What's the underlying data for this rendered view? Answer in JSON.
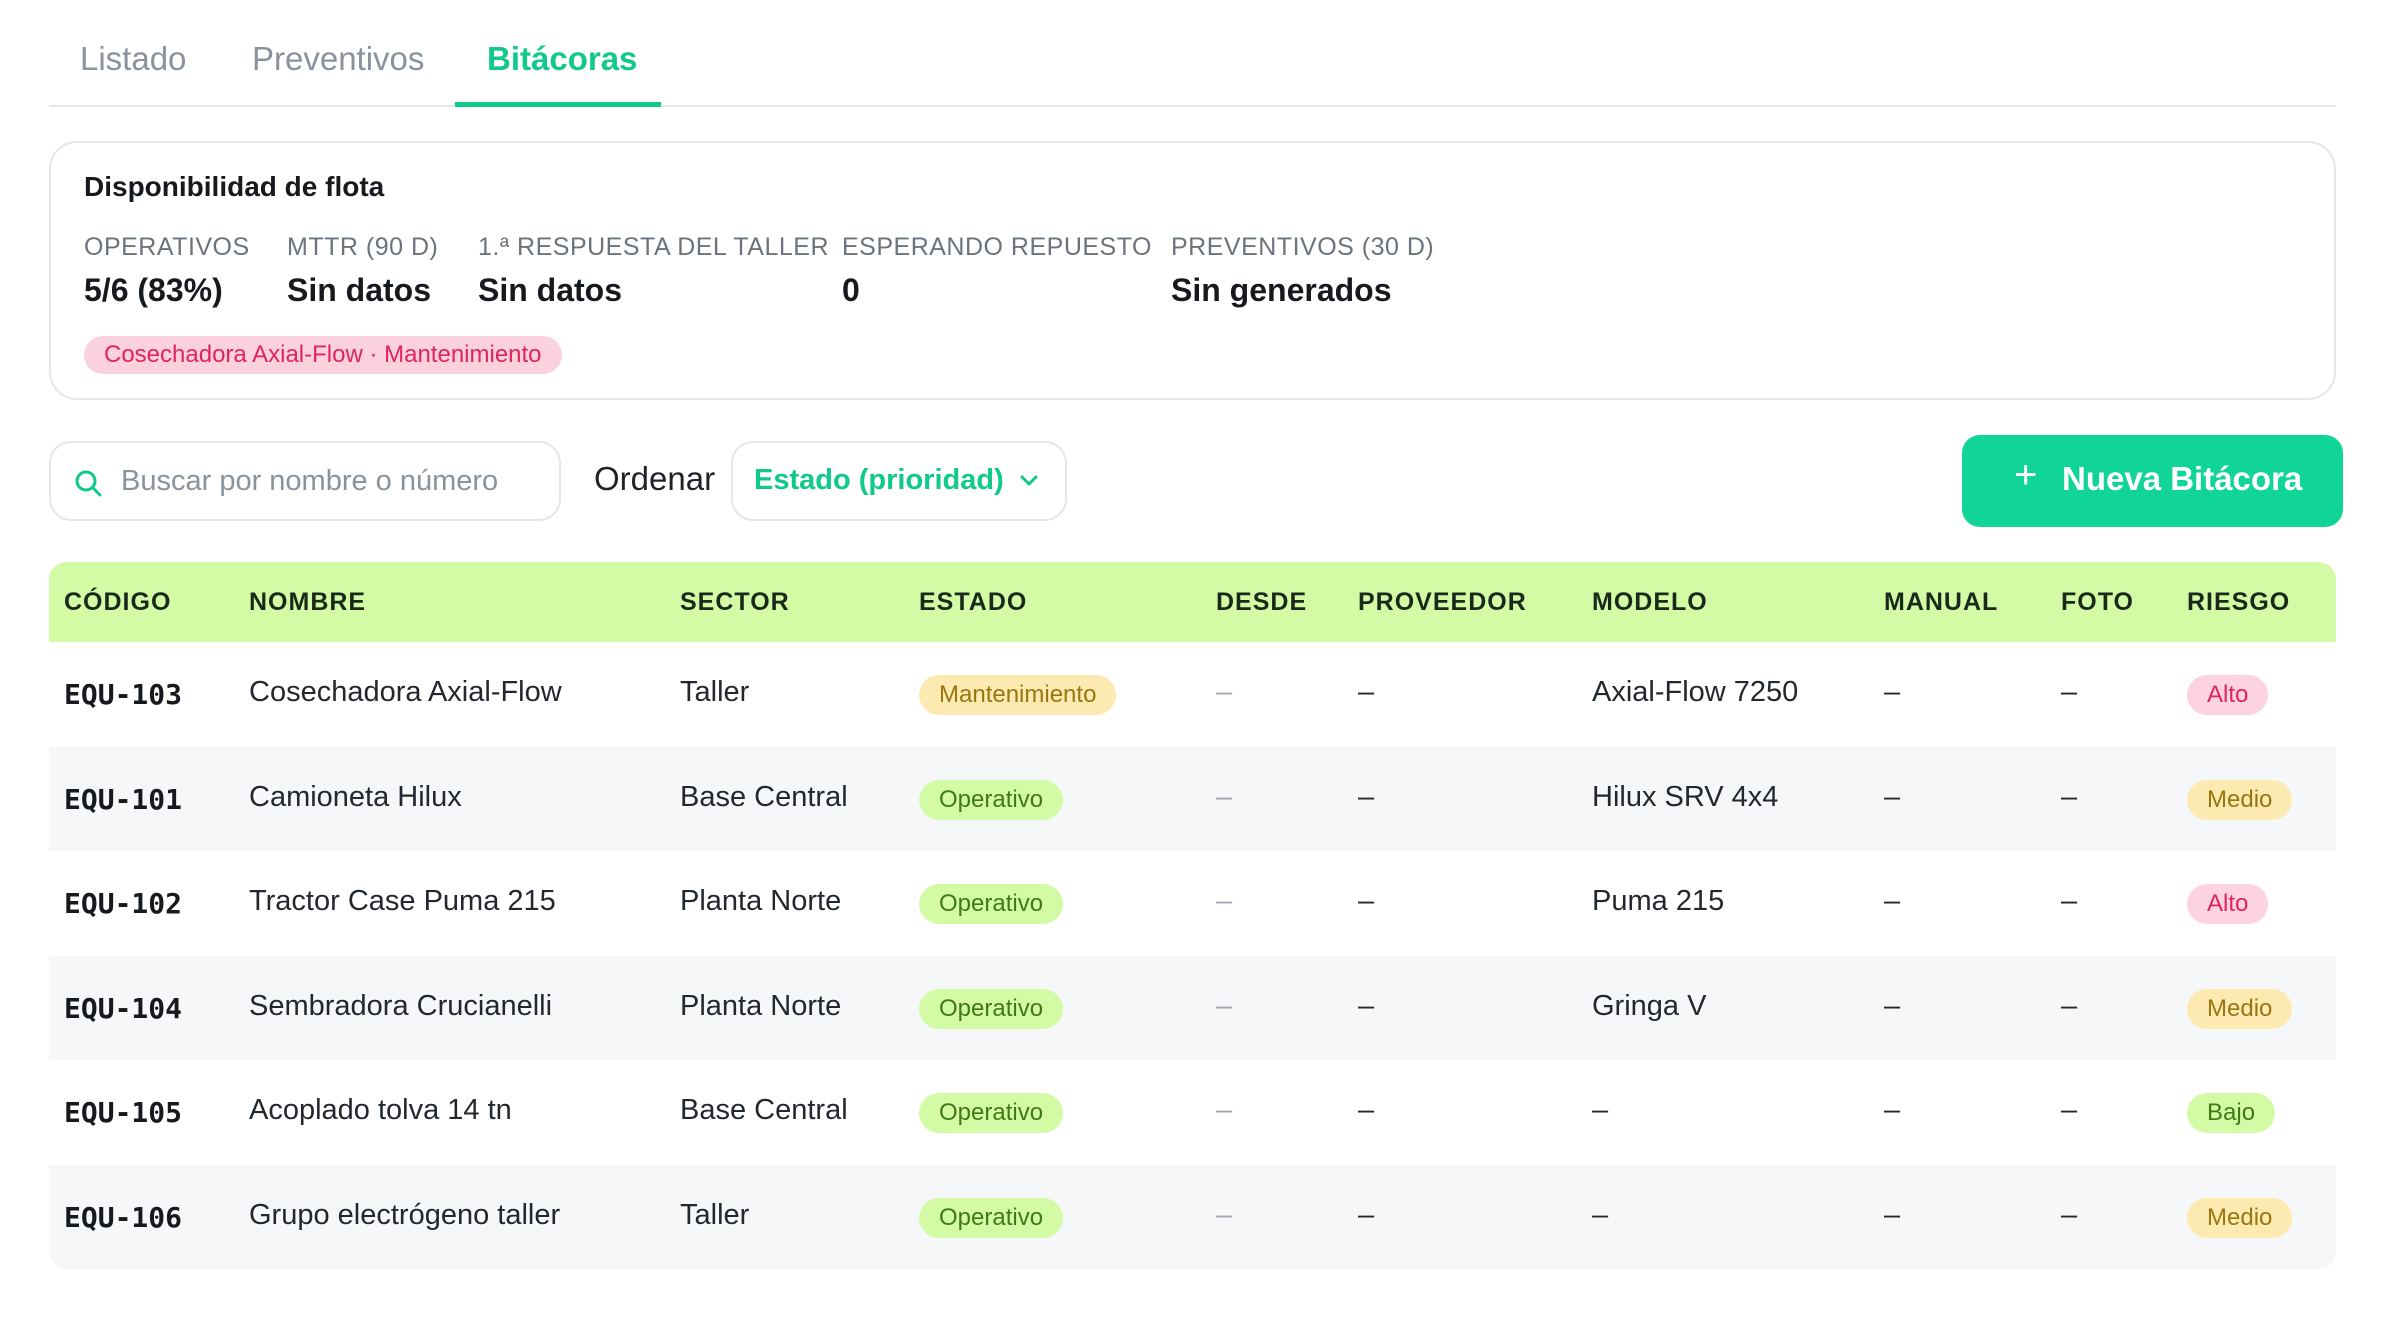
{
  "tabs": [
    {
      "label": "Listado"
    },
    {
      "label": "Preventivos"
    },
    {
      "label": "Bitácoras"
    }
  ],
  "fleet": {
    "title": "Disponibilidad de flota",
    "metrics": [
      {
        "label": "OPERATIVOS",
        "value": "5/6 (83%)"
      },
      {
        "label": "MTTR (90 D)",
        "value": "Sin datos"
      },
      {
        "label": "1.ª RESPUESTA DEL TALLER",
        "value": "Sin datos"
      },
      {
        "label": "ESPERANDO REPUESTO",
        "value": "0"
      },
      {
        "label": "PREVENTIVOS (30 D)",
        "value": "Sin generados"
      }
    ],
    "alert_chip": "Cosechadora Axial-Flow · Mantenimiento"
  },
  "controls": {
    "search_placeholder": "Buscar por nombre o número",
    "sort_label": "Ordenar",
    "sort_value": "Estado (prioridad)",
    "new_button": "Nueva Bitácora"
  },
  "colors": {
    "accent": "#10c98a",
    "header_bg": "#d3fba6"
  },
  "table": {
    "headers": [
      "CÓDIGO",
      "NOMBRE",
      "SECTOR",
      "ESTADO",
      "DESDE",
      "PROVEEDOR",
      "MODELO",
      "MANUAL",
      "FOTO",
      "RIESGO"
    ],
    "rows": [
      {
        "codigo": "EQU-103",
        "nombre": "Cosechadora Axial-Flow",
        "sector": "Taller",
        "estado": "Mantenimiento",
        "desde": "–",
        "proveedor": "–",
        "modelo": "Axial-Flow 7250",
        "manual": "–",
        "foto": "–",
        "riesgo": "Alto"
      },
      {
        "codigo": "EQU-101",
        "nombre": "Camioneta Hilux",
        "sector": "Base Central",
        "estado": "Operativo",
        "desde": "–",
        "proveedor": "–",
        "modelo": "Hilux SRV 4x4",
        "manual": "–",
        "foto": "–",
        "riesgo": "Medio"
      },
      {
        "codigo": "EQU-102",
        "nombre": "Tractor Case Puma 215",
        "sector": "Planta Norte",
        "estado": "Operativo",
        "desde": "–",
        "proveedor": "–",
        "modelo": "Puma 215",
        "manual": "–",
        "foto": "–",
        "riesgo": "Alto"
      },
      {
        "codigo": "EQU-104",
        "nombre": "Sembradora Crucianelli",
        "sector": "Planta Norte",
        "estado": "Operativo",
        "desde": "–",
        "proveedor": "–",
        "modelo": "Gringa V",
        "manual": "–",
        "foto": "–",
        "riesgo": "Medio"
      },
      {
        "codigo": "EQU-105",
        "nombre": "Acoplado tolva 14 tn",
        "sector": "Base Central",
        "estado": "Operativo",
        "desde": "–",
        "proveedor": "–",
        "modelo": "–",
        "manual": "–",
        "foto": "–",
        "riesgo": "Bajo"
      },
      {
        "codigo": "EQU-106",
        "nombre": "Grupo electrógeno taller",
        "sector": "Taller",
        "estado": "Operativo",
        "desde": "–",
        "proveedor": "–",
        "modelo": "–",
        "manual": "–",
        "foto": "–",
        "riesgo": "Medio"
      }
    ]
  }
}
